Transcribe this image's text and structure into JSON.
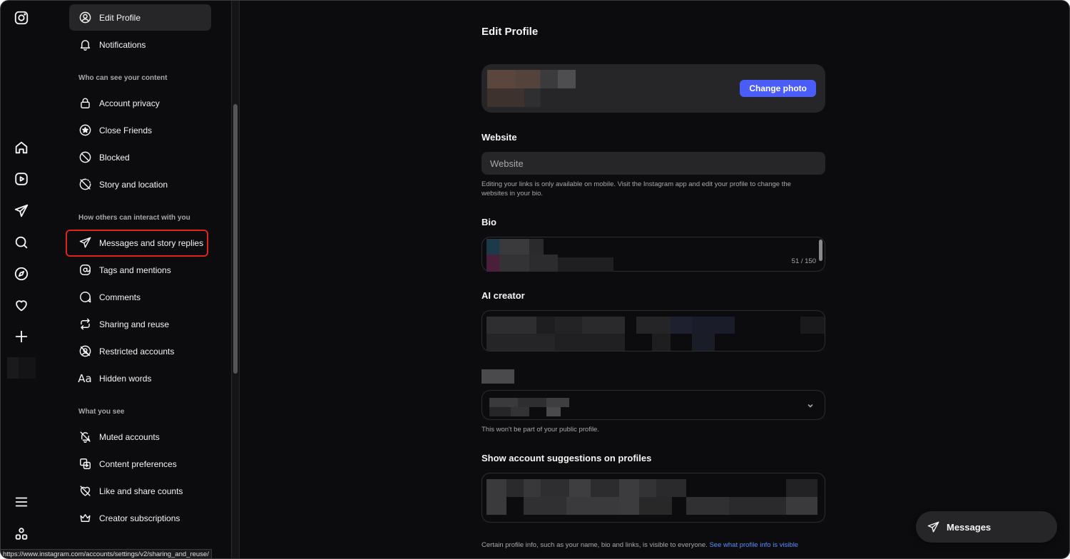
{
  "settings_nav": {
    "top_items": [
      {
        "label": "Edit Profile",
        "icon": "user-circle-icon",
        "active": true
      },
      {
        "label": "Notifications",
        "icon": "bell-icon",
        "active": false
      }
    ],
    "sections": [
      {
        "heading": "Who can see your content",
        "items": [
          {
            "label": "Account privacy",
            "icon": "lock-icon"
          },
          {
            "label": "Close Friends",
            "icon": "star-circle-icon"
          },
          {
            "label": "Blocked",
            "icon": "blocked-icon"
          },
          {
            "label": "Story and location",
            "icon": "story-off-icon"
          }
        ]
      },
      {
        "heading": "How others can interact with you",
        "items": [
          {
            "label": "Messages and story replies",
            "icon": "send-icon"
          },
          {
            "label": "Tags and mentions",
            "icon": "at-sign-icon"
          },
          {
            "label": "Comments",
            "icon": "comment-icon"
          },
          {
            "label": "Sharing and reuse",
            "icon": "repost-icon"
          },
          {
            "label": "Restricted accounts",
            "icon": "restricted-icon"
          },
          {
            "label": "Hidden words",
            "icon": "text-aa-icon",
            "glyph": "Aa"
          }
        ]
      },
      {
        "heading": "What you see",
        "items": [
          {
            "label": "Muted accounts",
            "icon": "bell-off-icon"
          },
          {
            "label": "Content preferences",
            "icon": "media-stack-icon"
          },
          {
            "label": "Like and share counts",
            "icon": "heart-off-icon"
          },
          {
            "label": "Creator subscriptions",
            "icon": "crown-icon"
          }
        ]
      }
    ]
  },
  "edit_profile": {
    "title": "Edit Profile",
    "change_photo_label": "Change photo",
    "website_label": "Website",
    "website_placeholder": "Website",
    "website_help": "Editing your links is only available on mobile. Visit the Instagram app and edit your profile to change the websites in your bio.",
    "bio_label": "Bio",
    "bio_counter": "51 / 150",
    "ai_creator_label": "AI creator",
    "gender_help": "This won't be part of your public profile.",
    "suggestions_label": "Show account suggestions on profiles",
    "footer_text": "Certain profile info, such as your name, bio and links, is visible to everyone. ",
    "footer_link": "See what profile info is visible"
  },
  "messages_pill": {
    "label": "Messages"
  },
  "status_url": "https://www.instagram.com/accounts/settings/v2/sharing_and_reuse/",
  "colors": {
    "background": "#0c0c0e",
    "surface": "#262628",
    "accent": "#4a5df9",
    "link": "#5b8cff",
    "highlight": "#e0241b"
  }
}
